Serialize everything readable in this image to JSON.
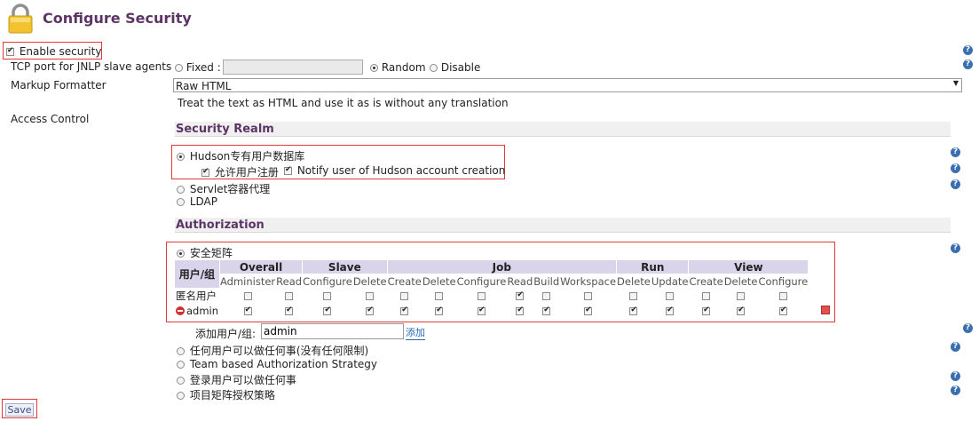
{
  "header": {
    "title": "Configure Security",
    "icon": "padlock-icon"
  },
  "enable_security": {
    "label": "Enable security",
    "checked": true
  },
  "tcp_port": {
    "label": "TCP port for JNLP slave agents",
    "options": {
      "fixed": "Fixed :",
      "random": "Random",
      "disable": "Disable"
    },
    "selected": "Random",
    "fixed_value": ""
  },
  "markup": {
    "label": "Markup Formatter",
    "selected": "Raw HTML",
    "description": "Treat the text as HTML and use it as is without any translation"
  },
  "access_control": {
    "label": "Access Control"
  },
  "security_realm": {
    "title": "Security Realm",
    "options": [
      {
        "label": "Hudson专有用户数据库",
        "selected": true
      },
      {
        "label": "Servlet容器代理",
        "selected": false
      },
      {
        "label": "LDAP",
        "selected": false
      }
    ],
    "allow_signup": {
      "label": "允许用户注册",
      "checked": true
    },
    "notify": {
      "label": "Notify user of Hudson account creation",
      "checked": true
    }
  },
  "authorization": {
    "title": "Authorization",
    "matrix_option": {
      "label": "安全矩阵",
      "selected": true
    },
    "user_group_header": "用户/组",
    "groups": [
      {
        "name": "Overall",
        "perms": [
          "Administer",
          "Read"
        ]
      },
      {
        "name": "Slave",
        "perms": [
          "Configure",
          "Delete"
        ]
      },
      {
        "name": "Job",
        "perms": [
          "Create",
          "Delete",
          "Configure",
          "Read",
          "Build",
          "Workspace"
        ]
      },
      {
        "name": "Run",
        "perms": [
          "Delete",
          "Update"
        ]
      },
      {
        "name": "View",
        "perms": [
          "Create",
          "Delete",
          "Configure"
        ]
      }
    ],
    "rows": [
      {
        "name": "匿名用户",
        "removable": false,
        "values": [
          false,
          false,
          false,
          false,
          false,
          false,
          false,
          true,
          false,
          false,
          false,
          false,
          false,
          false,
          false
        ]
      },
      {
        "name": "admin",
        "removable": true,
        "values": [
          true,
          true,
          true,
          true,
          true,
          true,
          true,
          true,
          true,
          true,
          true,
          true,
          true,
          true,
          true
        ]
      }
    ],
    "add_user": {
      "label": "添加用户/组:",
      "value": "admin",
      "button": "添加"
    },
    "other_options": [
      {
        "label": "任何用户可以做任何事(没有任何限制)",
        "selected": false
      },
      {
        "label": "Team based Authorization Strategy",
        "selected": false
      },
      {
        "label": "登录用户可以做任何事",
        "selected": false
      },
      {
        "label": "项目矩阵授权策略",
        "selected": false
      }
    ]
  },
  "save_button": {
    "label": "Save"
  },
  "colors": {
    "accent": "#5c3566",
    "highlight_border": "#e03b3b",
    "header_fill": "#d9d4ea",
    "help": "#3a6fb0"
  }
}
